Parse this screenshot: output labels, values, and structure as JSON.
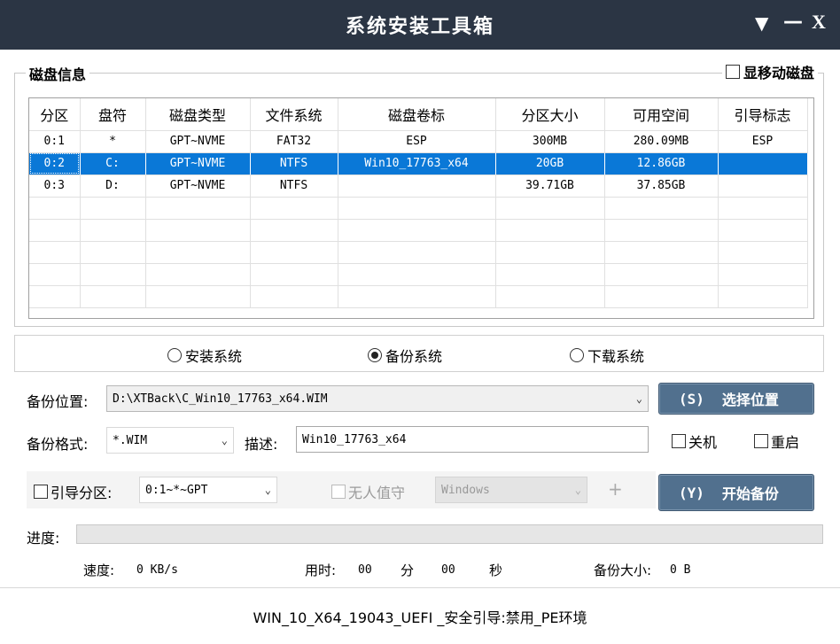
{
  "window": {
    "title": "系统安装工具箱",
    "menu_glyph": "▼",
    "minimize_glyph": "—",
    "close_glyph": "X"
  },
  "disk_info": {
    "group_label": "磁盘信息",
    "show_removable_label": "显移动磁盘",
    "show_removable_checked": false,
    "columns": [
      "分区",
      "盘符",
      "磁盘类型",
      "文件系统",
      "磁盘卷标",
      "分区大小",
      "可用空间",
      "引导标志"
    ],
    "rows": [
      {
        "cells": [
          "0:1",
          "*",
          "GPT~NVME",
          "FAT32",
          "ESP",
          "300MB",
          "280.09MB",
          "ESP"
        ],
        "selected": false
      },
      {
        "cells": [
          "0:2",
          "C:",
          "GPT~NVME",
          "NTFS",
          "Win10_17763_x64",
          "20GB",
          "12.86GB",
          ""
        ],
        "selected": true
      },
      {
        "cells": [
          "0:3",
          "D:",
          "GPT~NVME",
          "NTFS",
          "",
          "39.71GB",
          "37.85GB",
          ""
        ],
        "selected": false
      }
    ]
  },
  "mode": {
    "options": [
      {
        "label": "安装系统",
        "selected": false
      },
      {
        "label": "备份系统",
        "selected": true
      },
      {
        "label": "下载系统",
        "selected": false
      }
    ]
  },
  "backup": {
    "location_label": "备份位置:",
    "location_value": "D:\\XTBack\\C_Win10_17763_x64.WIM",
    "select_button_hotkey": "(S)",
    "select_button_label": "选择位置",
    "format_label": "备份格式:",
    "format_value": "*.WIM",
    "desc_label": "描述:",
    "desc_value": "Win10_17763_x64",
    "shutdown_label": "关机",
    "restart_label": "重启",
    "boot_partition_label": "引导分区:",
    "boot_partition_value": "0:1~*~GPT",
    "unattended_label": "无人值守",
    "unattended_value": "Windows",
    "plus_glyph": "+",
    "start_button_hotkey": "(Y)",
    "start_button_label": "开始备份"
  },
  "progress": {
    "label": "进度:",
    "fraction": 0
  },
  "stats": {
    "speed_label": "速度:",
    "speed_value": "0 KB/s",
    "time_label": "用时:",
    "minutes_value": "00",
    "minutes_unit": "分",
    "seconds_value": "00",
    "seconds_unit": "秒",
    "size_label": "备份大小:",
    "size_value": "0 B"
  },
  "status": {
    "text": "WIN_10_X64_19043_UEFI _安全引导:禁用_PE环境"
  },
  "colors": {
    "titlebar": "#2b3544",
    "selection": "#0a78d7",
    "button": "#51708e"
  }
}
